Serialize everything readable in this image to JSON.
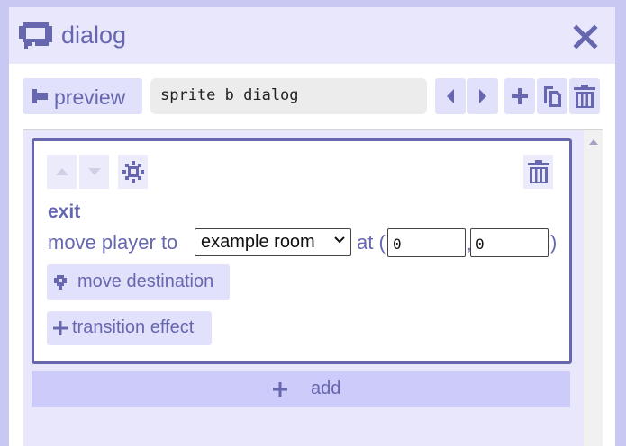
{
  "titlebar": {
    "title": "dialog",
    "icon": "speech-bubble-icon",
    "close_icon": "close-icon"
  },
  "toolbar": {
    "preview_label": "preview",
    "dialog_name": "sprite b dialog",
    "icons": [
      "preview-icon",
      "prev-icon",
      "next-icon",
      "add-icon",
      "copy-icon",
      "delete-icon"
    ]
  },
  "card": {
    "title": "exit",
    "move_text": "move player to",
    "room": "example room",
    "at_text": "at (",
    "x": "0",
    "comma": ",",
    "y": "0",
    "close_paren": ")",
    "destination_label": "move destination",
    "transition_label": "transition effect"
  },
  "add_label": "add",
  "colors": {
    "accent": "#6767b0",
    "button_bg": "#e2e1fb",
    "panel_bg": "#e8e7fb",
    "window_bg": "#c9c8f2"
  }
}
